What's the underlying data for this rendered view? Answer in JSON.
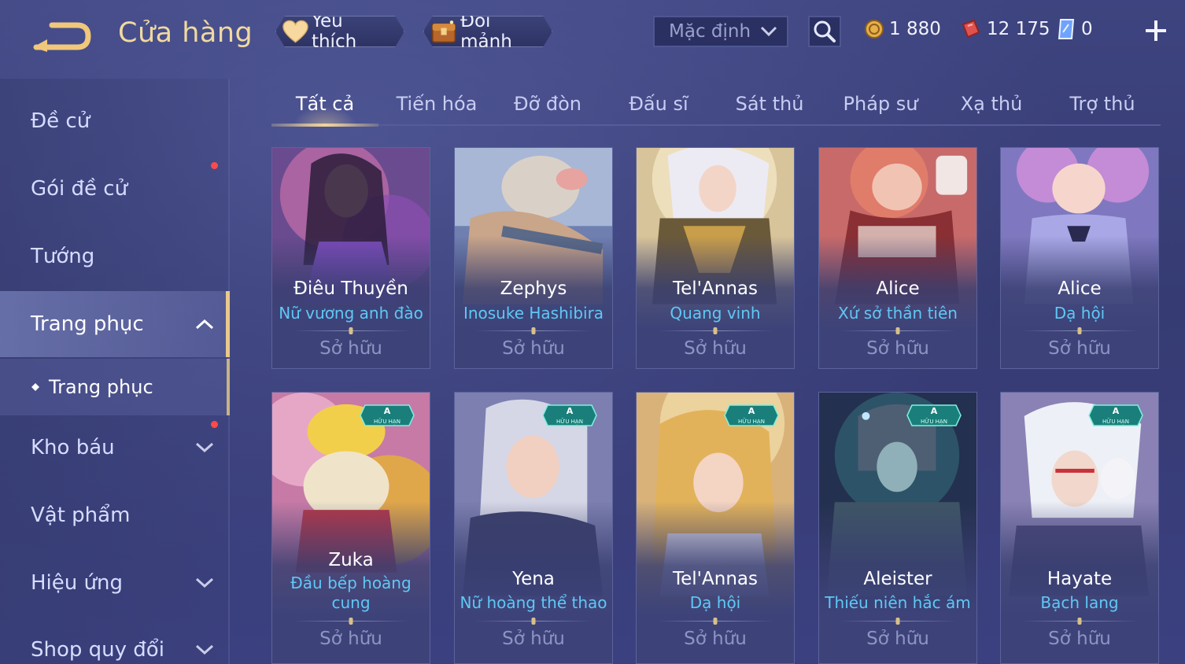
{
  "header": {
    "title": "Cửa hàng",
    "favorite_label": "Yêu thích",
    "exchange_label": "Đổi mảnh",
    "sort_value": "Mặc định",
    "currencies": [
      {
        "icon": "gold-coin-icon",
        "value": "1 880",
        "color": "#e6b04a"
      },
      {
        "icon": "red-voucher-icon",
        "value": "12 175",
        "color": "#e0524f"
      },
      {
        "icon": "diamond-icon",
        "value": "0",
        "color": "#6fa3ff"
      }
    ]
  },
  "sidebar": {
    "items": [
      {
        "label": "Đề cử"
      },
      {
        "label": "Gói đề cử"
      },
      {
        "label": "Tướng"
      },
      {
        "label": "Trang phục"
      },
      {
        "label": "Kho báu"
      },
      {
        "label": "Vật phẩm"
      },
      {
        "label": "Hiệu ứng"
      },
      {
        "label": "Shop quy đổi"
      }
    ],
    "sub_item": "Trang phục"
  },
  "tabs": [
    "Tất cả",
    "Tiến hóa",
    "Đỡ đòn",
    "Đấu sĩ",
    "Sát thủ",
    "Pháp sư",
    "Xạ thủ",
    "Trợ thủ"
  ],
  "cards": [
    {
      "hero": "Điêu Thuyền",
      "skin": "Nữ vương anh đào",
      "status": "Sở hữu",
      "badge": null
    },
    {
      "hero": "Zephys",
      "skin": "Inosuke Hashibira",
      "status": "Sở hữu",
      "badge": null
    },
    {
      "hero": "Tel'Annas",
      "skin": "Quang vinh",
      "status": "Sở hữu",
      "badge": null
    },
    {
      "hero": "Alice",
      "skin": "Xứ sở thần tiên",
      "status": "Sở hữu",
      "badge": null
    },
    {
      "hero": "Alice",
      "skin": "Dạ hội",
      "status": "Sở hữu",
      "badge": null
    },
    {
      "hero": "Zuka",
      "skin": "Đầu bếp hoàng cung",
      "status": "Sở hữu",
      "badge": {
        "grade": "A",
        "text": "HỮU HẠN"
      }
    },
    {
      "hero": "Yena",
      "skin": "Nữ hoàng thể thao",
      "status": "Sở hữu",
      "badge": {
        "grade": "A",
        "text": "HỮU HẠN"
      }
    },
    {
      "hero": "Tel'Annas",
      "skin": "Dạ hội",
      "status": "Sở hữu",
      "badge": {
        "grade": "A",
        "text": "HỮU HẠN"
      }
    },
    {
      "hero": "Aleister",
      "skin": "Thiếu niên hắc ám",
      "status": "Sở hữu",
      "badge": {
        "grade": "A",
        "text": "HỮU HẠN"
      }
    },
    {
      "hero": "Hayate",
      "skin": "Bạch lang",
      "status": "Sở hữu",
      "badge": {
        "grade": "A",
        "text": "HỮU HẠN"
      }
    }
  ]
}
